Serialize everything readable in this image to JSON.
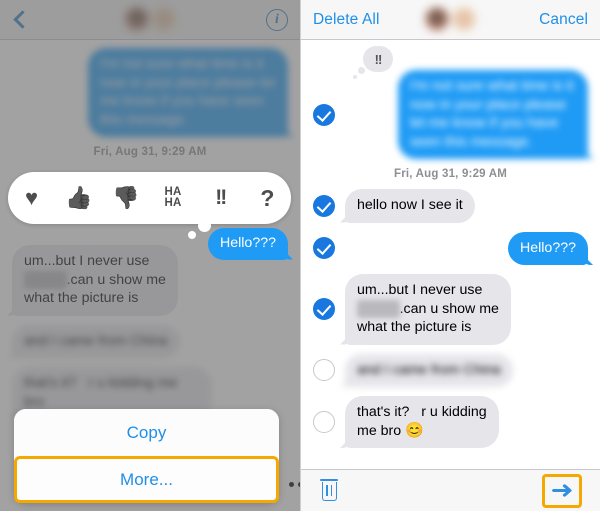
{
  "left_panel": {
    "header": {
      "back_icon": "chevron-left-icon",
      "avatar": "blurred-contact-avatar",
      "info_icon": "info-circle-icon"
    },
    "messages": [
      {
        "id": "m1",
        "direction": "out",
        "text": "I'm not sure what time is it now in your place please let me know if you have seen this message.",
        "blurred": true
      }
    ],
    "timestamp": "Fri, Aug 31, 9:29 AM",
    "tapback_bar": {
      "label": "Tapback reactions",
      "options": [
        {
          "name": "heart",
          "glyph": "♥"
        },
        {
          "name": "thumbs-up",
          "glyph": "👍"
        },
        {
          "name": "thumbs-down",
          "glyph": "👎"
        },
        {
          "name": "haha",
          "line1": "HA",
          "line2": "HA"
        },
        {
          "name": "exclamation",
          "glyph": "!!"
        },
        {
          "name": "question",
          "glyph": "?"
        }
      ]
    },
    "highlighted_bubble": "Hello???",
    "lower_messages": [
      {
        "id": "m2",
        "direction": "in",
        "line1": "um...but I never use",
        "blur_word": "xxxxxx",
        "line1_rest": ".can u show me",
        "line2": "what the picture is",
        "blurred": false
      },
      {
        "id": "m3",
        "direction": "in",
        "text": "and I came from China",
        "blurred": true
      },
      {
        "id": "m4",
        "direction": "in",
        "text": "that's it?   r u kidding me bro",
        "blurred": true
      }
    ],
    "action_sheet": {
      "copy_label": "Copy",
      "more_label": "More...",
      "selected_item": "More...",
      "overflow_icon": "ellipsis-icon"
    }
  },
  "right_panel": {
    "header": {
      "delete_all_label": "Delete All",
      "cancel_label": "Cancel",
      "avatar": "blurred-contact-avatar"
    },
    "timestamp": "Fri, Aug 31, 9:29 AM",
    "messages": [
      {
        "id": "r1",
        "direction": "out",
        "text": "I'm not sure what time is it now in your place please let me know if you have seen this message.",
        "blurred": true,
        "selected": true,
        "tapback": "!!"
      },
      {
        "id": "r2",
        "direction": "in",
        "text": "hello now I see it",
        "blurred": false,
        "selected": true
      },
      {
        "id": "r3",
        "direction": "out",
        "text": "Hello???",
        "blurred": false,
        "selected": true
      },
      {
        "id": "r4",
        "direction": "in",
        "line1": "um...but I never use",
        "blur_word": "xxxxxx",
        "line1_rest": ".can u show me",
        "line2": "what the picture is",
        "blurred": false,
        "selected": true
      },
      {
        "id": "r5",
        "direction": "in",
        "text": "and I came from China",
        "blurred": true,
        "selected": false
      },
      {
        "id": "r6",
        "direction": "in",
        "line1": "that's it?   r u kidding",
        "line2": "me bro ",
        "emoji": "😊",
        "blurred": false,
        "selected": false
      }
    ],
    "toolbar": {
      "trash_icon": "trash-icon",
      "forward_icon": "forward-arrow-icon",
      "forward_highlighted": true
    }
  },
  "colors": {
    "accent_blue": "#1f9bf5",
    "link_blue": "#1f8fe8",
    "check_blue": "#1878e0",
    "incoming_gray": "#e5e5ea",
    "highlight_yellow": "#f5a800",
    "dim_overlay": "rgba(105,105,105,0.62)"
  }
}
